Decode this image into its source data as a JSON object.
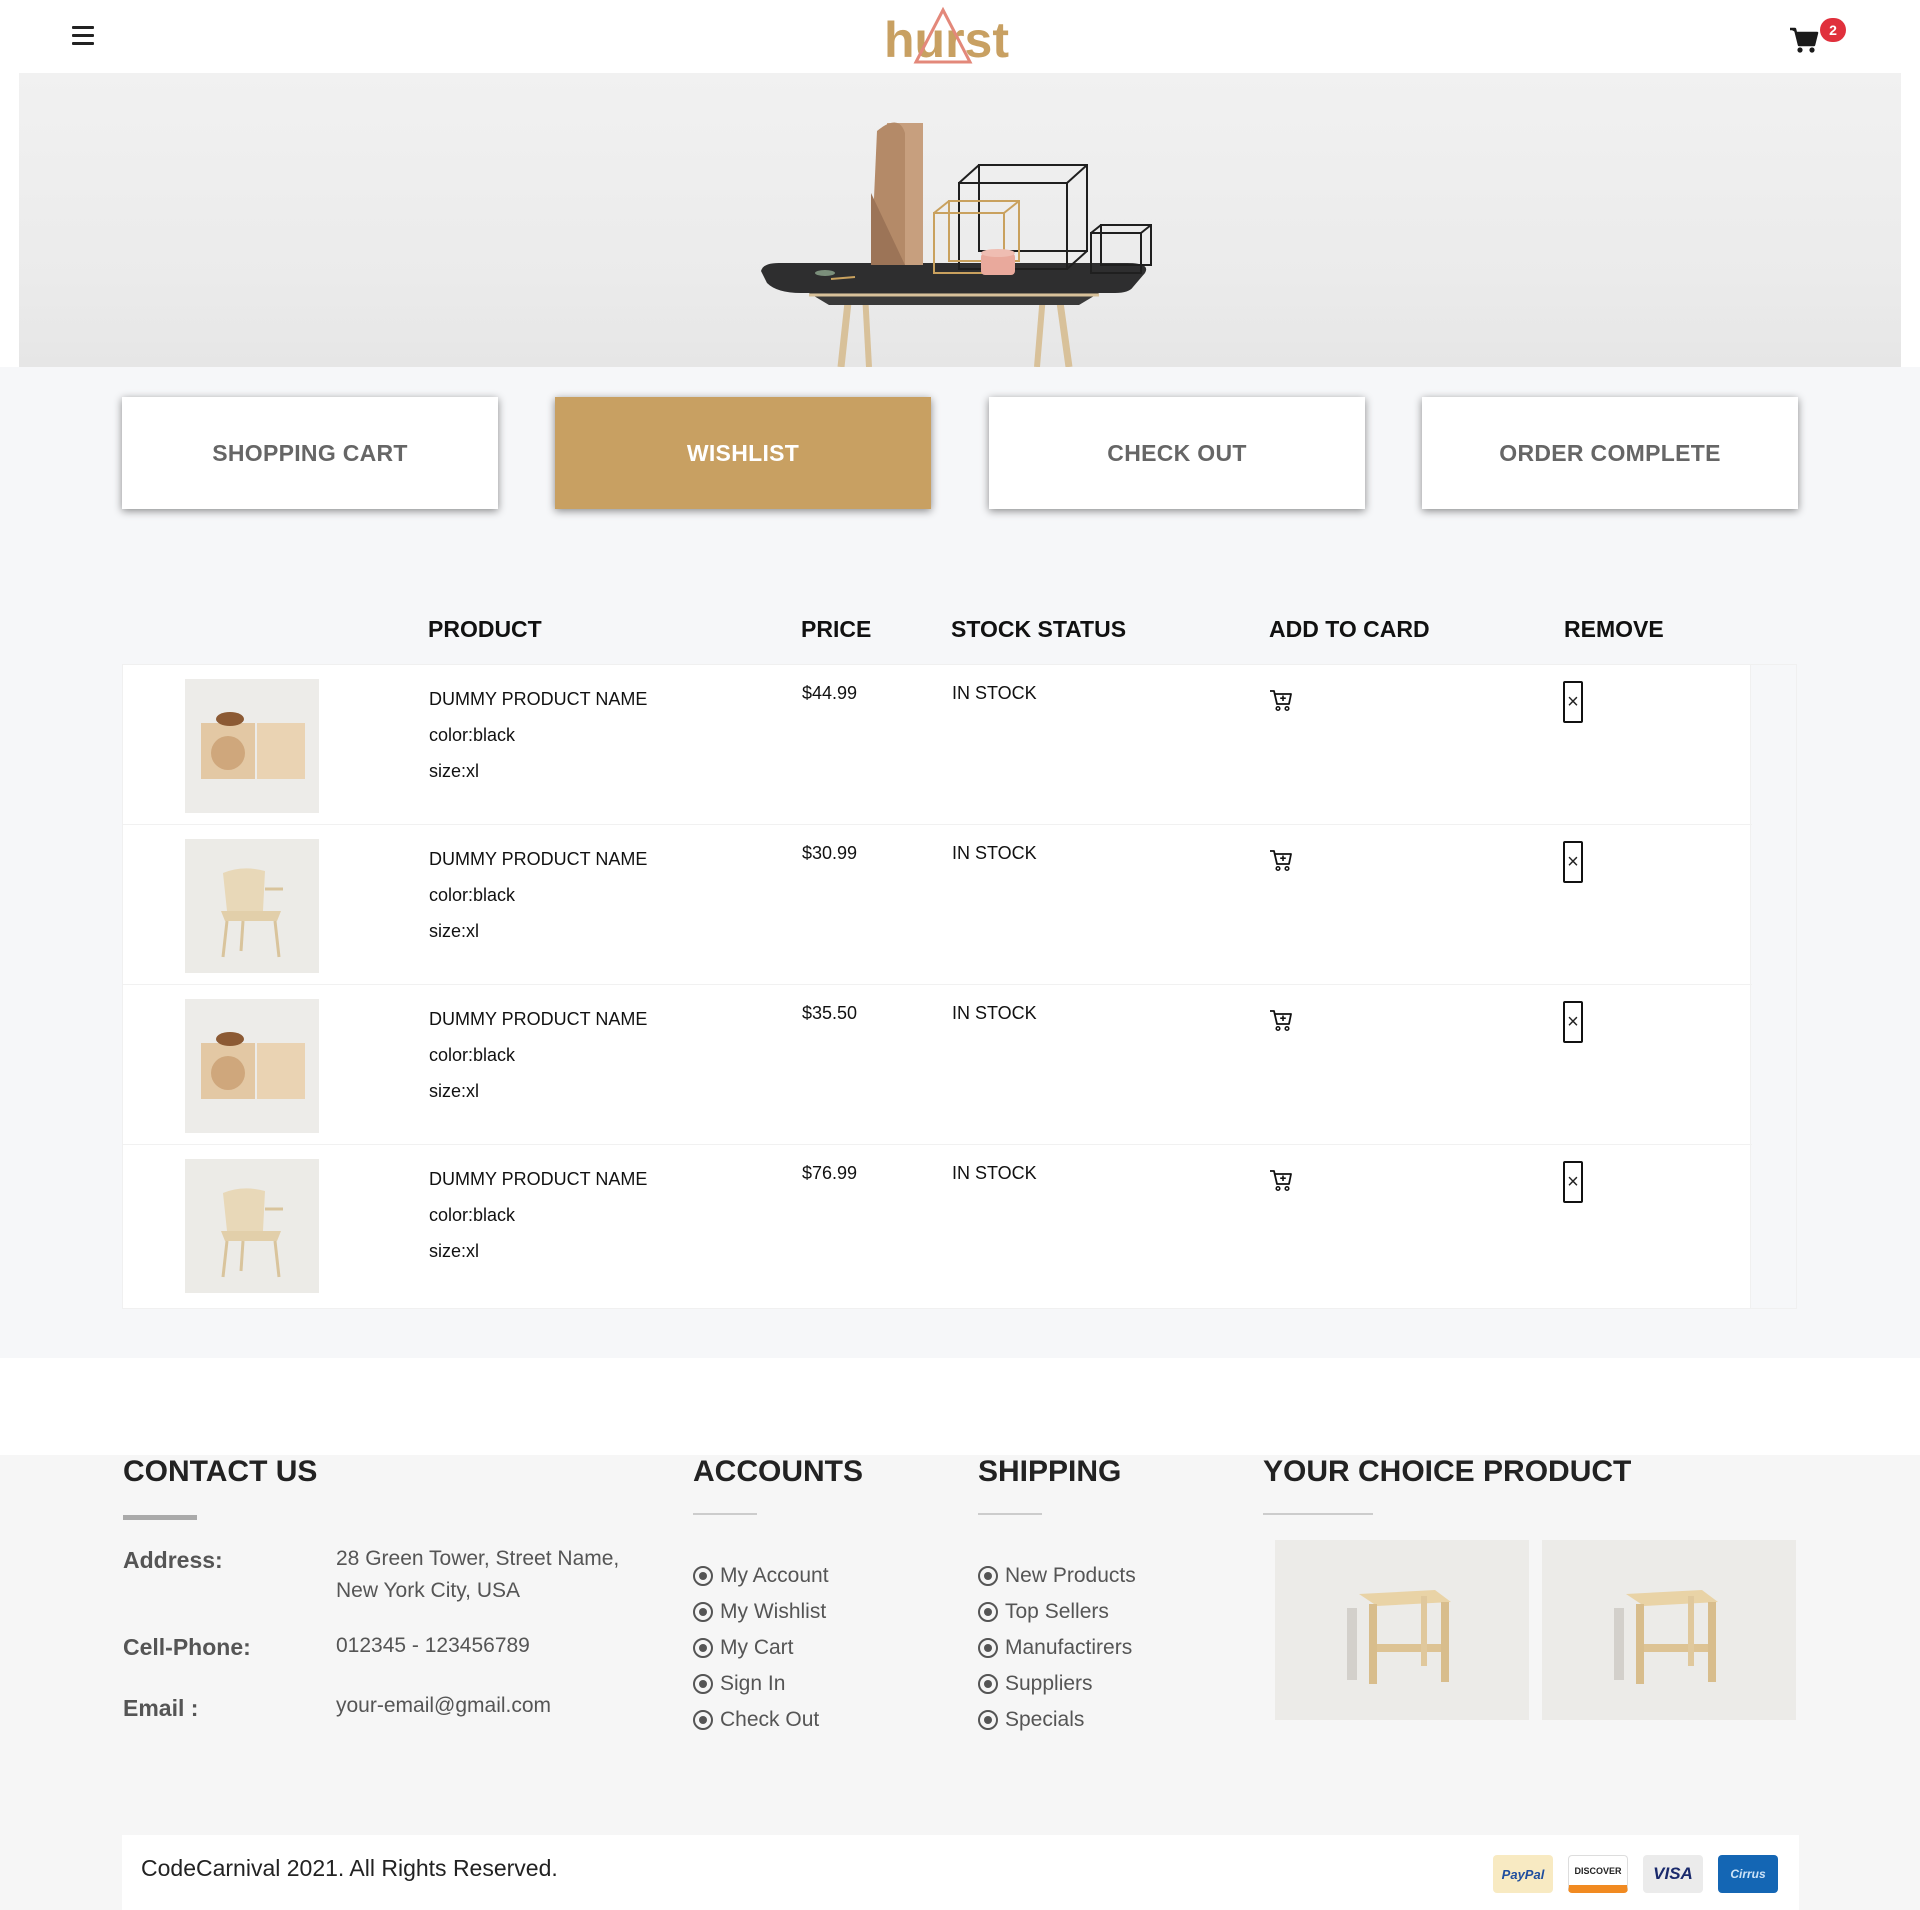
{
  "header": {
    "logo_text": "hurst",
    "cart_count": "2"
  },
  "steps": [
    {
      "label": "SHOPPING CART",
      "active": false
    },
    {
      "label": "WISHLIST",
      "active": true
    },
    {
      "label": "CHECK OUT",
      "active": false
    },
    {
      "label": "ORDER COMPLETE",
      "active": false
    }
  ],
  "table": {
    "headers": {
      "product": "PRODUCT",
      "price": "PRICE",
      "stock": "STOCK STATUS",
      "add": "ADD TO CARD",
      "remove": "REMOVE"
    },
    "rows": [
      {
        "name": "DUMMY PRODUCT NAME",
        "color": "color:black",
        "size": "size:xl",
        "price": "$44.99",
        "stock": "IN STOCK",
        "image": "wooden-box"
      },
      {
        "name": "DUMMY PRODUCT NAME",
        "color": "color:black",
        "size": "size:xl",
        "price": "$30.99",
        "stock": "IN STOCK",
        "image": "wooden-chair"
      },
      {
        "name": "DUMMY PRODUCT NAME",
        "color": "color:black",
        "size": "size:xl",
        "price": "$35.50",
        "stock": "IN STOCK",
        "image": "wooden-box"
      },
      {
        "name": "DUMMY PRODUCT NAME",
        "color": "color:black",
        "size": "size:xl",
        "price": "$76.99",
        "stock": "IN STOCK",
        "image": "wooden-chair"
      }
    ],
    "remove_symbol": "×"
  },
  "footer": {
    "contact": {
      "title": "CONTACT US",
      "address_label": "Address:",
      "address_line1": "28 Green Tower, Street Name,",
      "address_line2": "New York City, USA",
      "phone_label": "Cell-Phone:",
      "phone": "012345 - 123456789",
      "email_label": "Email :",
      "email": "your-email@gmail.com"
    },
    "accounts": {
      "title": "ACCOUNTS",
      "items": [
        "My Account",
        "My Wishlist",
        "My Cart",
        "Sign In",
        "Check Out"
      ]
    },
    "shipping": {
      "title": "SHIPPING",
      "items": [
        "New Products",
        "Top Sellers",
        "Manufactirers",
        "Suppliers",
        "Specials"
      ]
    },
    "choice": {
      "title": "YOUR CHOICE PRODUCT"
    },
    "copyright": "CodeCarnival 2021. All Rights Reserved.",
    "payments": {
      "paypal": "PayPal",
      "discover": "DISCOVER",
      "visa": "VISA",
      "cirrus": "Cirrus"
    }
  },
  "colors": {
    "accent": "#c8a062",
    "badge": "#e0303c",
    "logo_triangle": "#e3887a"
  }
}
